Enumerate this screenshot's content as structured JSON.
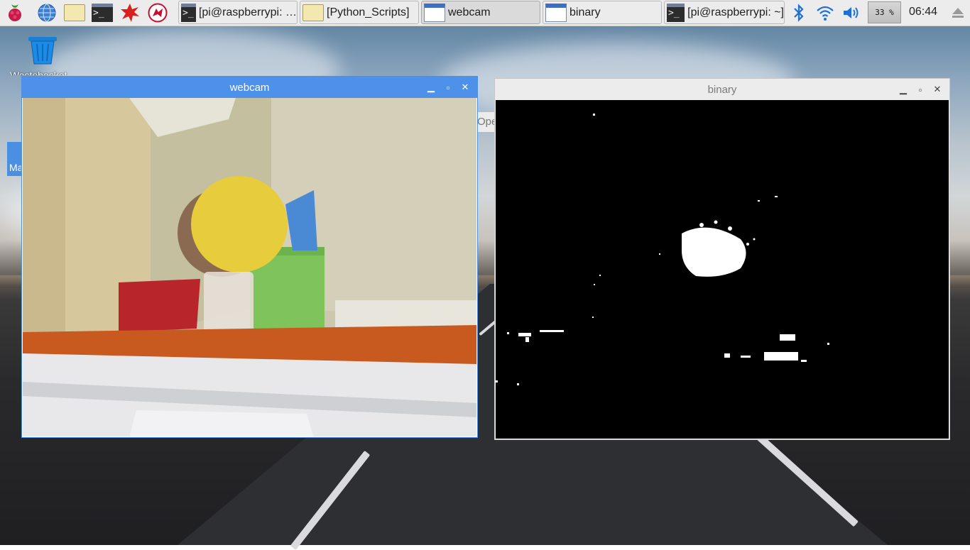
{
  "taskbar": {
    "launchers": [
      {
        "icon": "raspberry-menu-icon"
      },
      {
        "icon": "web-browser-icon"
      },
      {
        "icon": "file-manager-icon"
      },
      {
        "icon": "terminal-icon"
      },
      {
        "icon": "math-kernel-icon"
      },
      {
        "icon": "wolfram-icon"
      }
    ],
    "tasks": [
      {
        "label": "[pi@raspberrypi: …",
        "icon": "terminal-icon"
      },
      {
        "label": "[Python_Scripts]",
        "icon": "folder-icon"
      },
      {
        "label": "webcam",
        "icon": "window-icon",
        "active": true
      },
      {
        "label": "binary",
        "icon": "window-icon"
      },
      {
        "label": "[pi@raspberrypi: ~]",
        "icon": "terminal-icon"
      }
    ],
    "tray": {
      "bluetooth_icon": "bluetooth-icon",
      "wifi_icon": "wifi-icon",
      "volume_icon": "volume-icon",
      "battery": "33 %",
      "clock": "06:44",
      "eject_icon": "eject-icon"
    }
  },
  "desktop": {
    "trash_label": "Wastebasket",
    "partial_window_text": "Ma",
    "partial_window2_text": "Ope"
  },
  "windows": {
    "webcam": {
      "title": "webcam"
    },
    "binary": {
      "title": "binary"
    }
  },
  "colors": {
    "active_titlebar": "#4d91ea",
    "inactive_titlebar": "#ececec",
    "accent_tray": "#1e6fd9"
  }
}
